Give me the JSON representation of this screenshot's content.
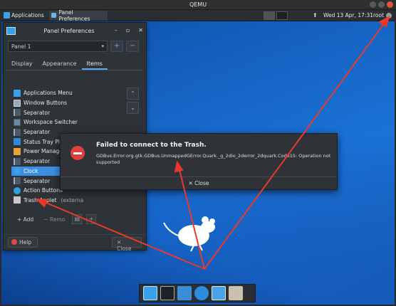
{
  "qemu": {
    "title": "QEMU"
  },
  "top_panel": {
    "apps_label": "Applications",
    "task_label": "Panel Preferences",
    "clock": "Wed 13 Apr, 17:31",
    "user": "root"
  },
  "prefs": {
    "title": "Panel Preferences",
    "panel_select": "Panel 1",
    "add_panel": "+",
    "remove_panel": "−",
    "tabs": [
      "Display",
      "Appearance",
      "Items"
    ],
    "items": [
      {
        "label": "Applications Menu",
        "icon": "apps-menu-icon",
        "extra": ""
      },
      {
        "label": "Window Buttons",
        "icon": "window-buttons-icon",
        "extra": ""
      },
      {
        "label": "Separator",
        "icon": "separator-icon",
        "extra": ""
      },
      {
        "label": "Workspace Switcher",
        "icon": "workspace-icon",
        "extra": ""
      },
      {
        "label": "Separator",
        "icon": "separator-icon",
        "extra": ""
      },
      {
        "label": "Status Tray Plugin (exte",
        "icon": "tray-icon",
        "extra": ""
      },
      {
        "label": "Power Manage",
        "icon": "power-icon",
        "extra": ""
      },
      {
        "label": "Separator",
        "icon": "separator-icon",
        "extra": ""
      },
      {
        "label": "Clock",
        "icon": "clock-icon",
        "extra": ""
      },
      {
        "label": "Separator",
        "icon": "separator-icon",
        "extra": ""
      },
      {
        "label": "Action Buttons",
        "icon": "action-icon",
        "extra": ""
      },
      {
        "label": "Trash Applet",
        "icon": "trash-icon",
        "extra": "(externa"
      }
    ],
    "add_label": "+ Add",
    "remove_label": "− Remo",
    "help_label": "Help",
    "close_label": "✕ Close"
  },
  "error_dialog": {
    "title": "Failed to connect to the Trash.",
    "message": "GDBus.Error:org.gtk.GDBus.UnmappedGError.Quark._g_2dio_2derror_2dquark.Code15: Operation not supported",
    "close_label": "✕ Close"
  },
  "colors": {
    "accent": "#3c8fe0",
    "error": "#e0403a",
    "annotation": "#e83a2a"
  }
}
